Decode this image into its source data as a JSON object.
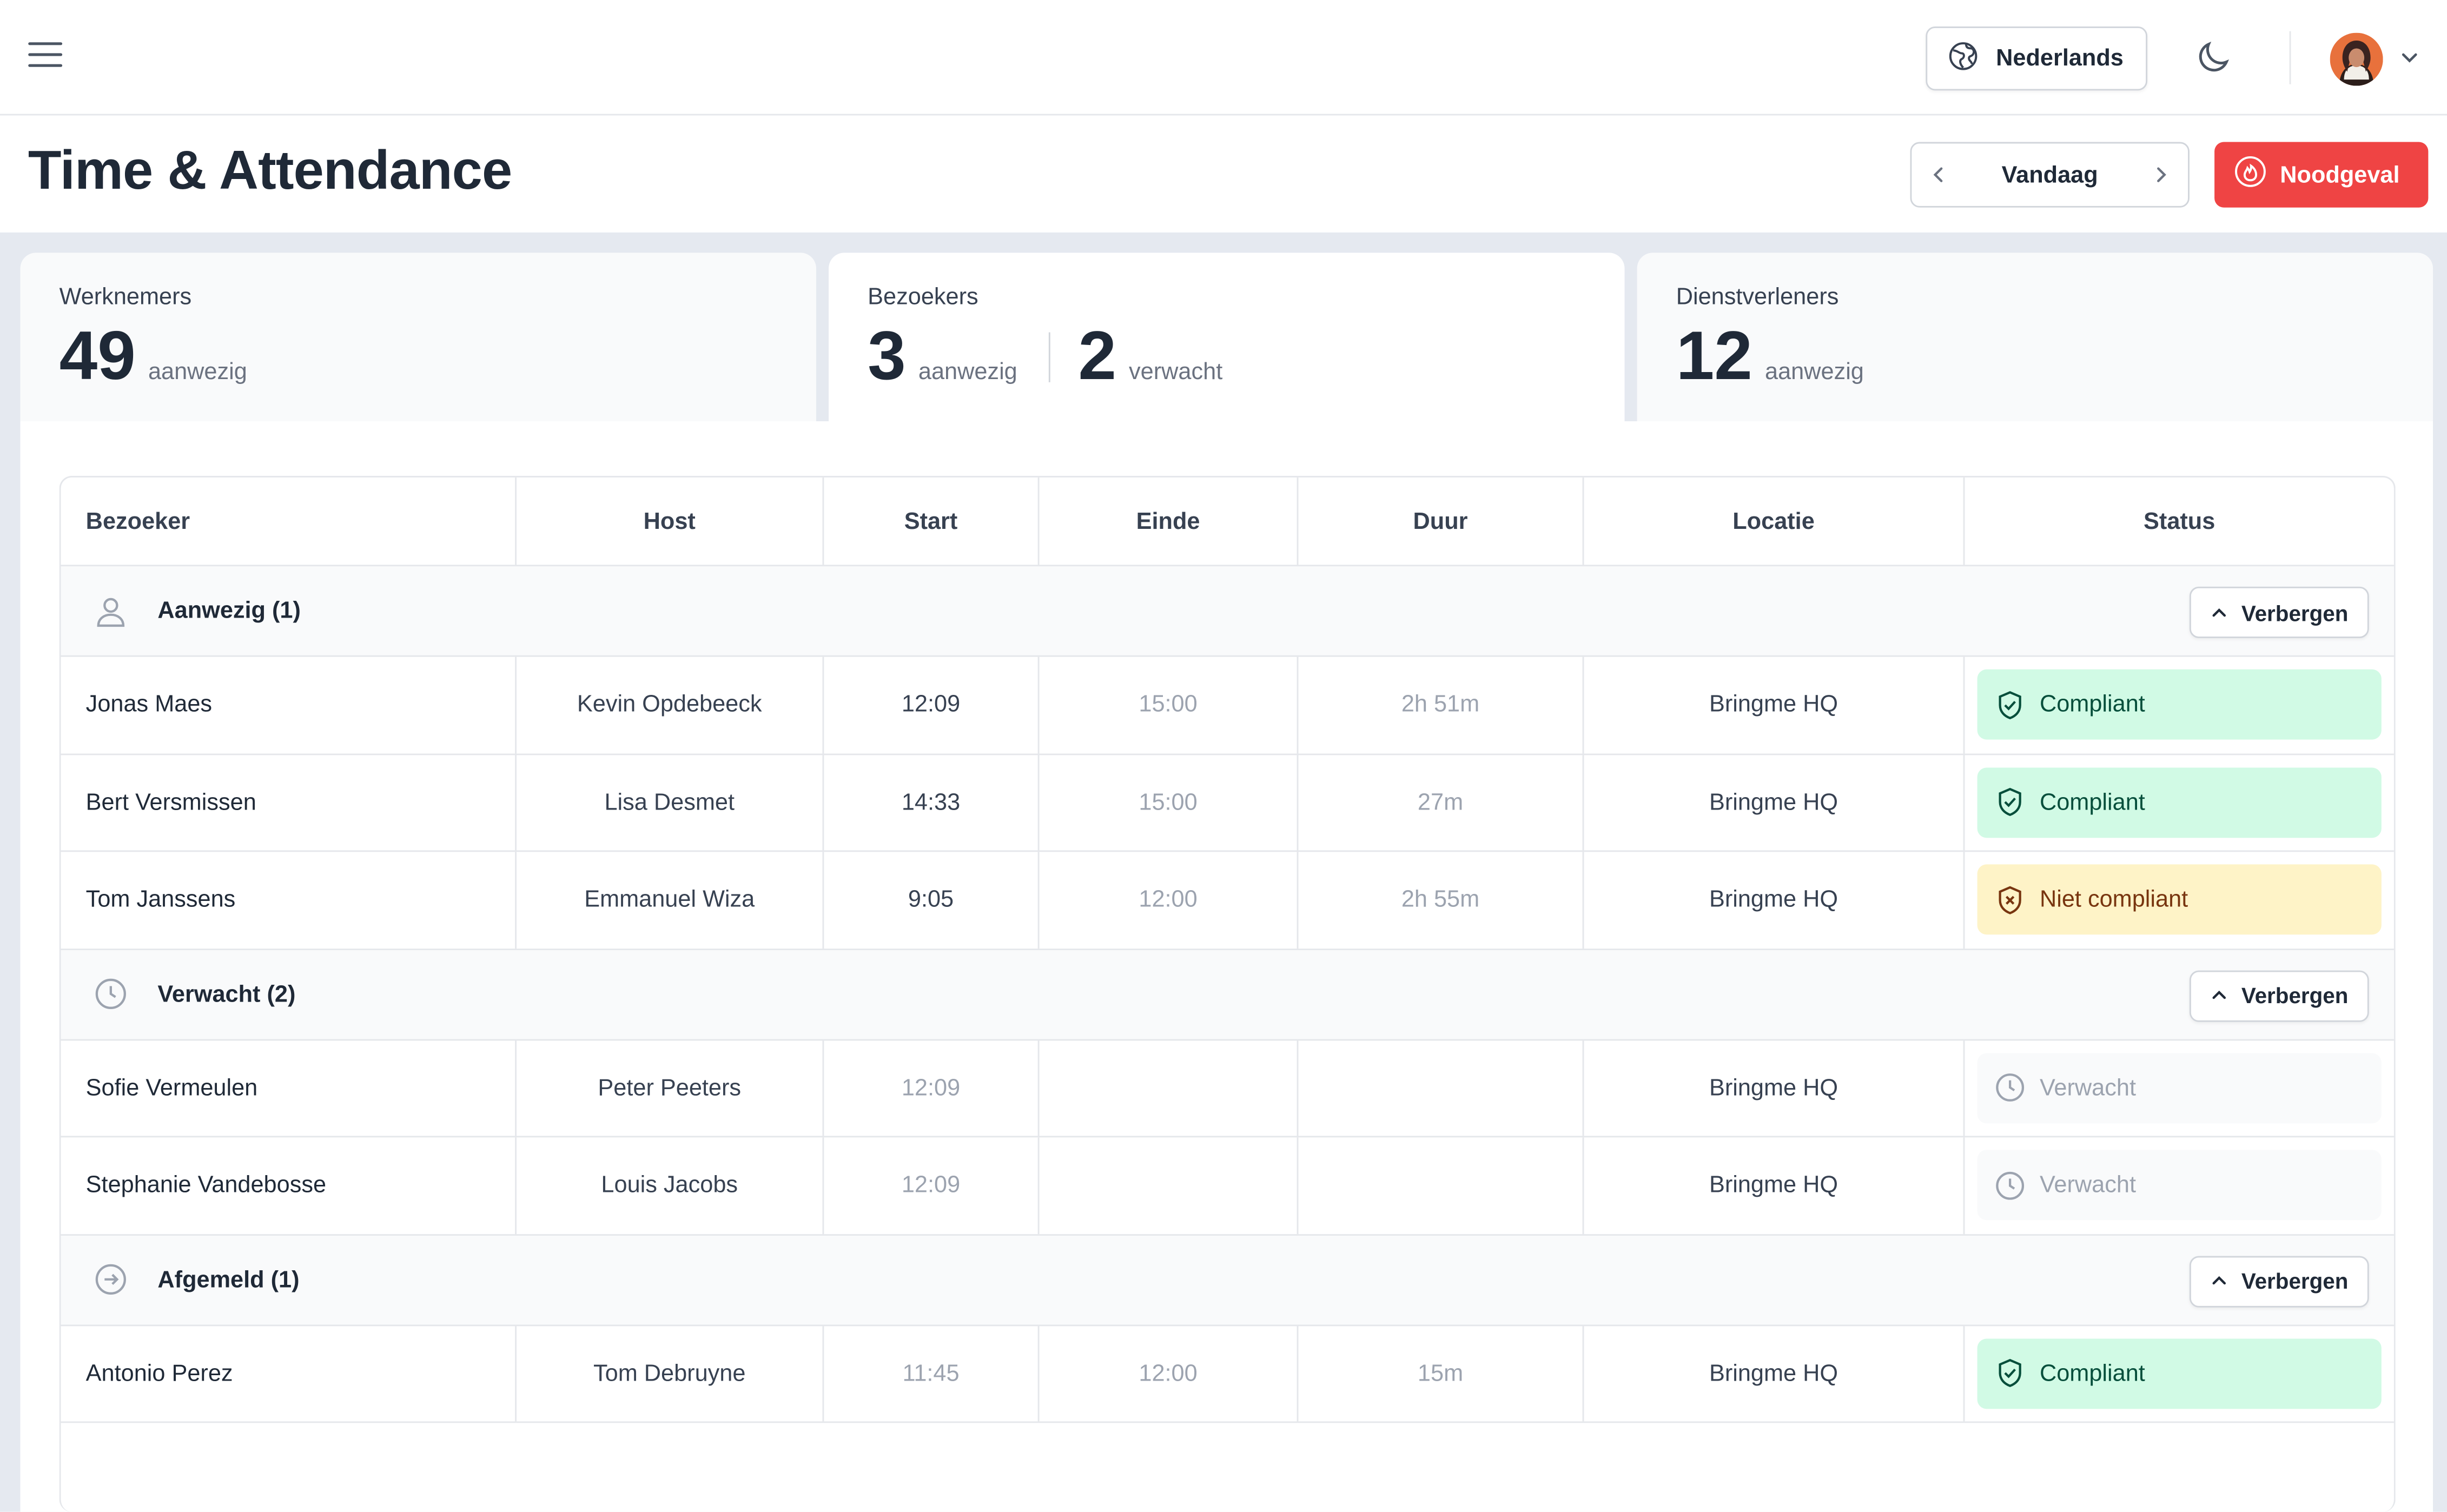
{
  "header": {
    "language": "Nederlands"
  },
  "page": {
    "title": "Time & Attendance",
    "date_label": "Vandaag",
    "emergency_label": "Noodgeval"
  },
  "cards": {
    "employees": {
      "title": "Werknemers",
      "present_count": "49",
      "present_label": "aanwezig"
    },
    "visitors": {
      "title": "Bezoekers",
      "present_count": "3",
      "present_label": "aanwezig",
      "expected_count": "2",
      "expected_label": "verwacht"
    },
    "providers": {
      "title": "Dienstverleners",
      "present_count": "12",
      "present_label": "aanwezig"
    }
  },
  "table": {
    "columns": [
      "Bezoeker",
      "Host",
      "Start",
      "Einde",
      "Duur",
      "Locatie",
      "Status"
    ],
    "hide_label": "Verbergen",
    "groups": [
      {
        "title": "Aanwezig (1)",
        "icon": "user-icon",
        "rows": [
          {
            "visitor": "Jonas Maes",
            "host": "Kevin Opdebeeck",
            "start": "12:09",
            "end": "15:00",
            "duration": "2h 51m",
            "location": "Bringme HQ",
            "status": "Compliant"
          },
          {
            "visitor": "Bert Versmissen",
            "host": "Lisa Desmet",
            "start": "14:33",
            "end": "15:00",
            "duration": "27m",
            "location": "Bringme HQ",
            "status": "Compliant"
          },
          {
            "visitor": "Tom Janssens",
            "host": "Emmanuel Wiza",
            "start": "9:05",
            "end": "12:00",
            "duration": "2h 55m",
            "location": "Bringme HQ",
            "status": "Niet compliant"
          }
        ]
      },
      {
        "title": "Verwacht (2)",
        "icon": "clock-icon",
        "rows": [
          {
            "visitor": "Sofie Vermeulen",
            "host": "Peter Peeters",
            "start": "12:09",
            "end": "",
            "duration": "",
            "location": "Bringme HQ",
            "status": "Verwacht"
          },
          {
            "visitor": "Stephanie Vandebosse",
            "host": "Louis Jacobs",
            "start": "12:09",
            "end": "",
            "duration": "",
            "location": "Bringme HQ",
            "status": "Verwacht"
          }
        ]
      },
      {
        "title": "Afgemeld (1)",
        "icon": "arrow-circle-icon",
        "rows": [
          {
            "visitor": "Antonio Perez",
            "host": "Tom Debruyne",
            "start": "11:45",
            "end": "12:00",
            "duration": "15m",
            "location": "Bringme HQ",
            "status": "Compliant"
          }
        ]
      }
    ]
  },
  "colors": {
    "accent_red": "#ef4444",
    "compliant_bg": "#d1fae5",
    "noncompliant_bg": "#fef3c7",
    "band_bg": "#e5e9f0"
  }
}
